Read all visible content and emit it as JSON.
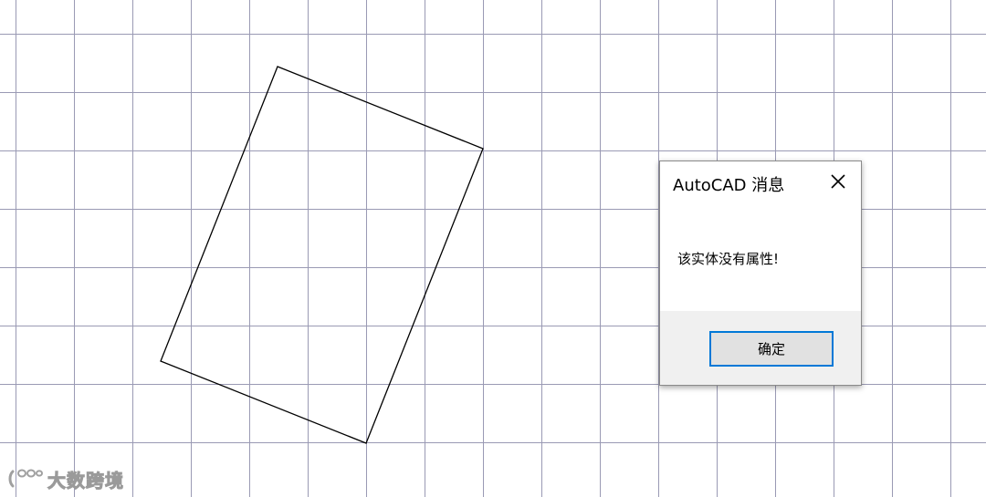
{
  "canvas": {
    "background": "#ffffff",
    "grid_color": "#9a9ab4",
    "shape_color": "#000000"
  },
  "dialog": {
    "title": "AutoCAD 消息",
    "close_icon": "close-icon",
    "message": "该实体没有属性!",
    "ok_label": "确定",
    "accent_color": "#0078d7"
  },
  "watermark": {
    "text": "大数跨境",
    "icon": "wechat-logo-icon"
  }
}
